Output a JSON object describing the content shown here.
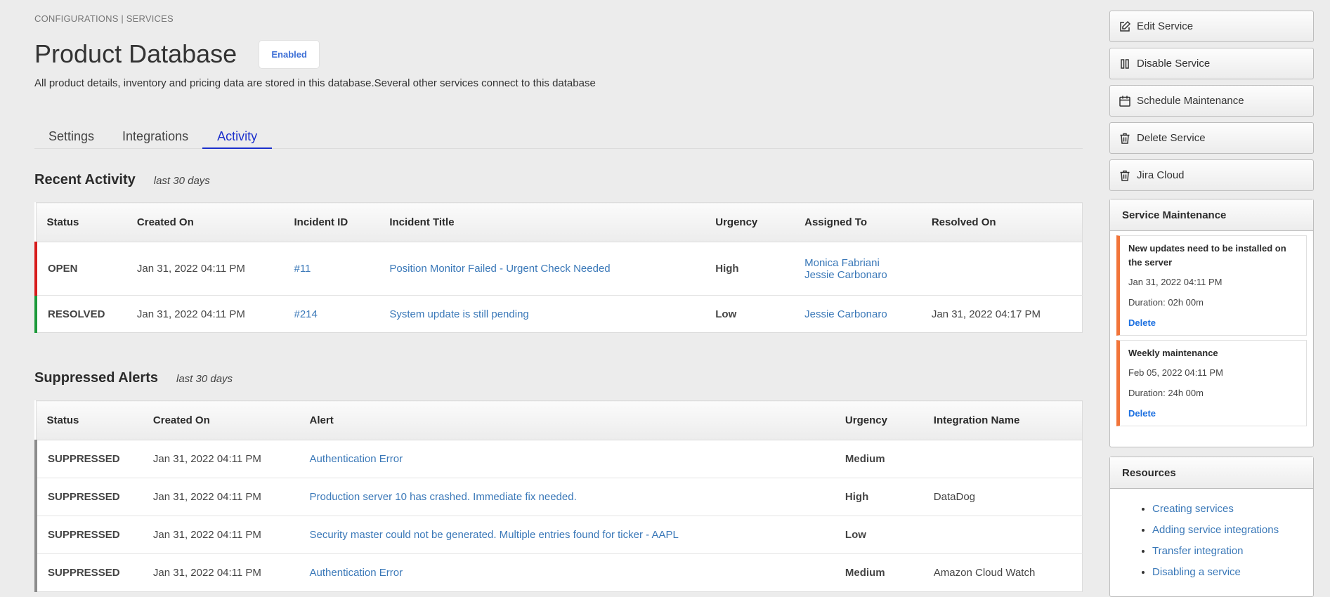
{
  "breadcrumb": "CONFIGURATIONS | SERVICES",
  "service": {
    "title": "Product Database",
    "status": "Enabled",
    "description": "All product details, inventory and pricing data are stored in this database.Several other services connect to this database"
  },
  "tabs": [
    {
      "label": "Settings"
    },
    {
      "label": "Integrations"
    },
    {
      "label": "Activity",
      "active": true
    }
  ],
  "recent_activity": {
    "title": "Recent Activity",
    "subtitle": "last 30 days",
    "columns": [
      "Status",
      "Created On",
      "Incident ID",
      "Incident Title",
      "Urgency",
      "Assigned To",
      "Resolved On"
    ],
    "rows": [
      {
        "status": "OPEN",
        "created_on": "Jan 31, 2022 04:11 PM",
        "incident_id": "#11",
        "incident_title": "Position Monitor Failed - Urgent Check Needed",
        "urgency": "High",
        "assigned_to": [
          "Monica Fabriani",
          "Jessie Carbonaro"
        ],
        "resolved_on": ""
      },
      {
        "status": "RESOLVED",
        "created_on": "Jan 31, 2022 04:11 PM",
        "incident_id": "#214",
        "incident_title": "System update is still pending",
        "urgency": "Low",
        "assigned_to": [
          "Jessie Carbonaro"
        ],
        "resolved_on": "Jan 31, 2022 04:17 PM"
      }
    ]
  },
  "suppressed_alerts": {
    "title": "Suppressed Alerts",
    "subtitle": "last 30 days",
    "columns": [
      "Status",
      "Created On",
      "Alert",
      "Urgency",
      "Integration Name"
    ],
    "rows": [
      {
        "status": "SUPPRESSED",
        "created_on": "Jan 31, 2022 04:11 PM",
        "alert": "Authentication Error",
        "urgency": "Medium",
        "integration": ""
      },
      {
        "status": "SUPPRESSED",
        "created_on": "Jan 31, 2022 04:11 PM",
        "alert": "Production server 10 has crashed. Immediate fix needed.",
        "urgency": "High",
        "integration": "DataDog"
      },
      {
        "status": "SUPPRESSED",
        "created_on": "Jan 31, 2022 04:11 PM",
        "alert": "Security master could not be generated. Multiple entries found for ticker - AAPL",
        "urgency": "Low",
        "integration": ""
      },
      {
        "status": "SUPPRESSED",
        "created_on": "Jan 31, 2022 04:11 PM",
        "alert": "Authentication Error",
        "urgency": "Medium",
        "integration": "Amazon Cloud Watch"
      }
    ]
  },
  "actions": [
    {
      "label": "Edit Service",
      "icon": "edit-icon"
    },
    {
      "label": "Disable Service",
      "icon": "pause-icon"
    },
    {
      "label": "Schedule Maintenance",
      "icon": "calendar-icon"
    },
    {
      "label": "Delete Service",
      "icon": "trash-icon"
    },
    {
      "label": "Jira Cloud",
      "icon": "trash-icon"
    }
  ],
  "maintenance": {
    "title": "Service Maintenance",
    "items": [
      {
        "title": "New updates need to be installed on the server",
        "date": "Jan 31, 2022 04:11 PM",
        "duration": "Duration: 02h 00m",
        "delete_label": "Delete"
      },
      {
        "title": "Weekly maintenance",
        "date": "Feb 05, 2022 04:11 PM",
        "duration": "Duration: 24h 00m",
        "delete_label": "Delete"
      }
    ]
  },
  "resources": {
    "title": "Resources",
    "links": [
      "Creating services",
      "Adding service integrations",
      "Transfer integration",
      "Disabling a service"
    ]
  },
  "colors": {
    "accent": "#1b2fcc",
    "link": "#3a78b8",
    "open_stripe": "#d71c1c",
    "resolved_stripe": "#1c9a3a",
    "suppressed_stripe": "#8c8c8c",
    "maintenance_stripe": "#f2753a"
  }
}
